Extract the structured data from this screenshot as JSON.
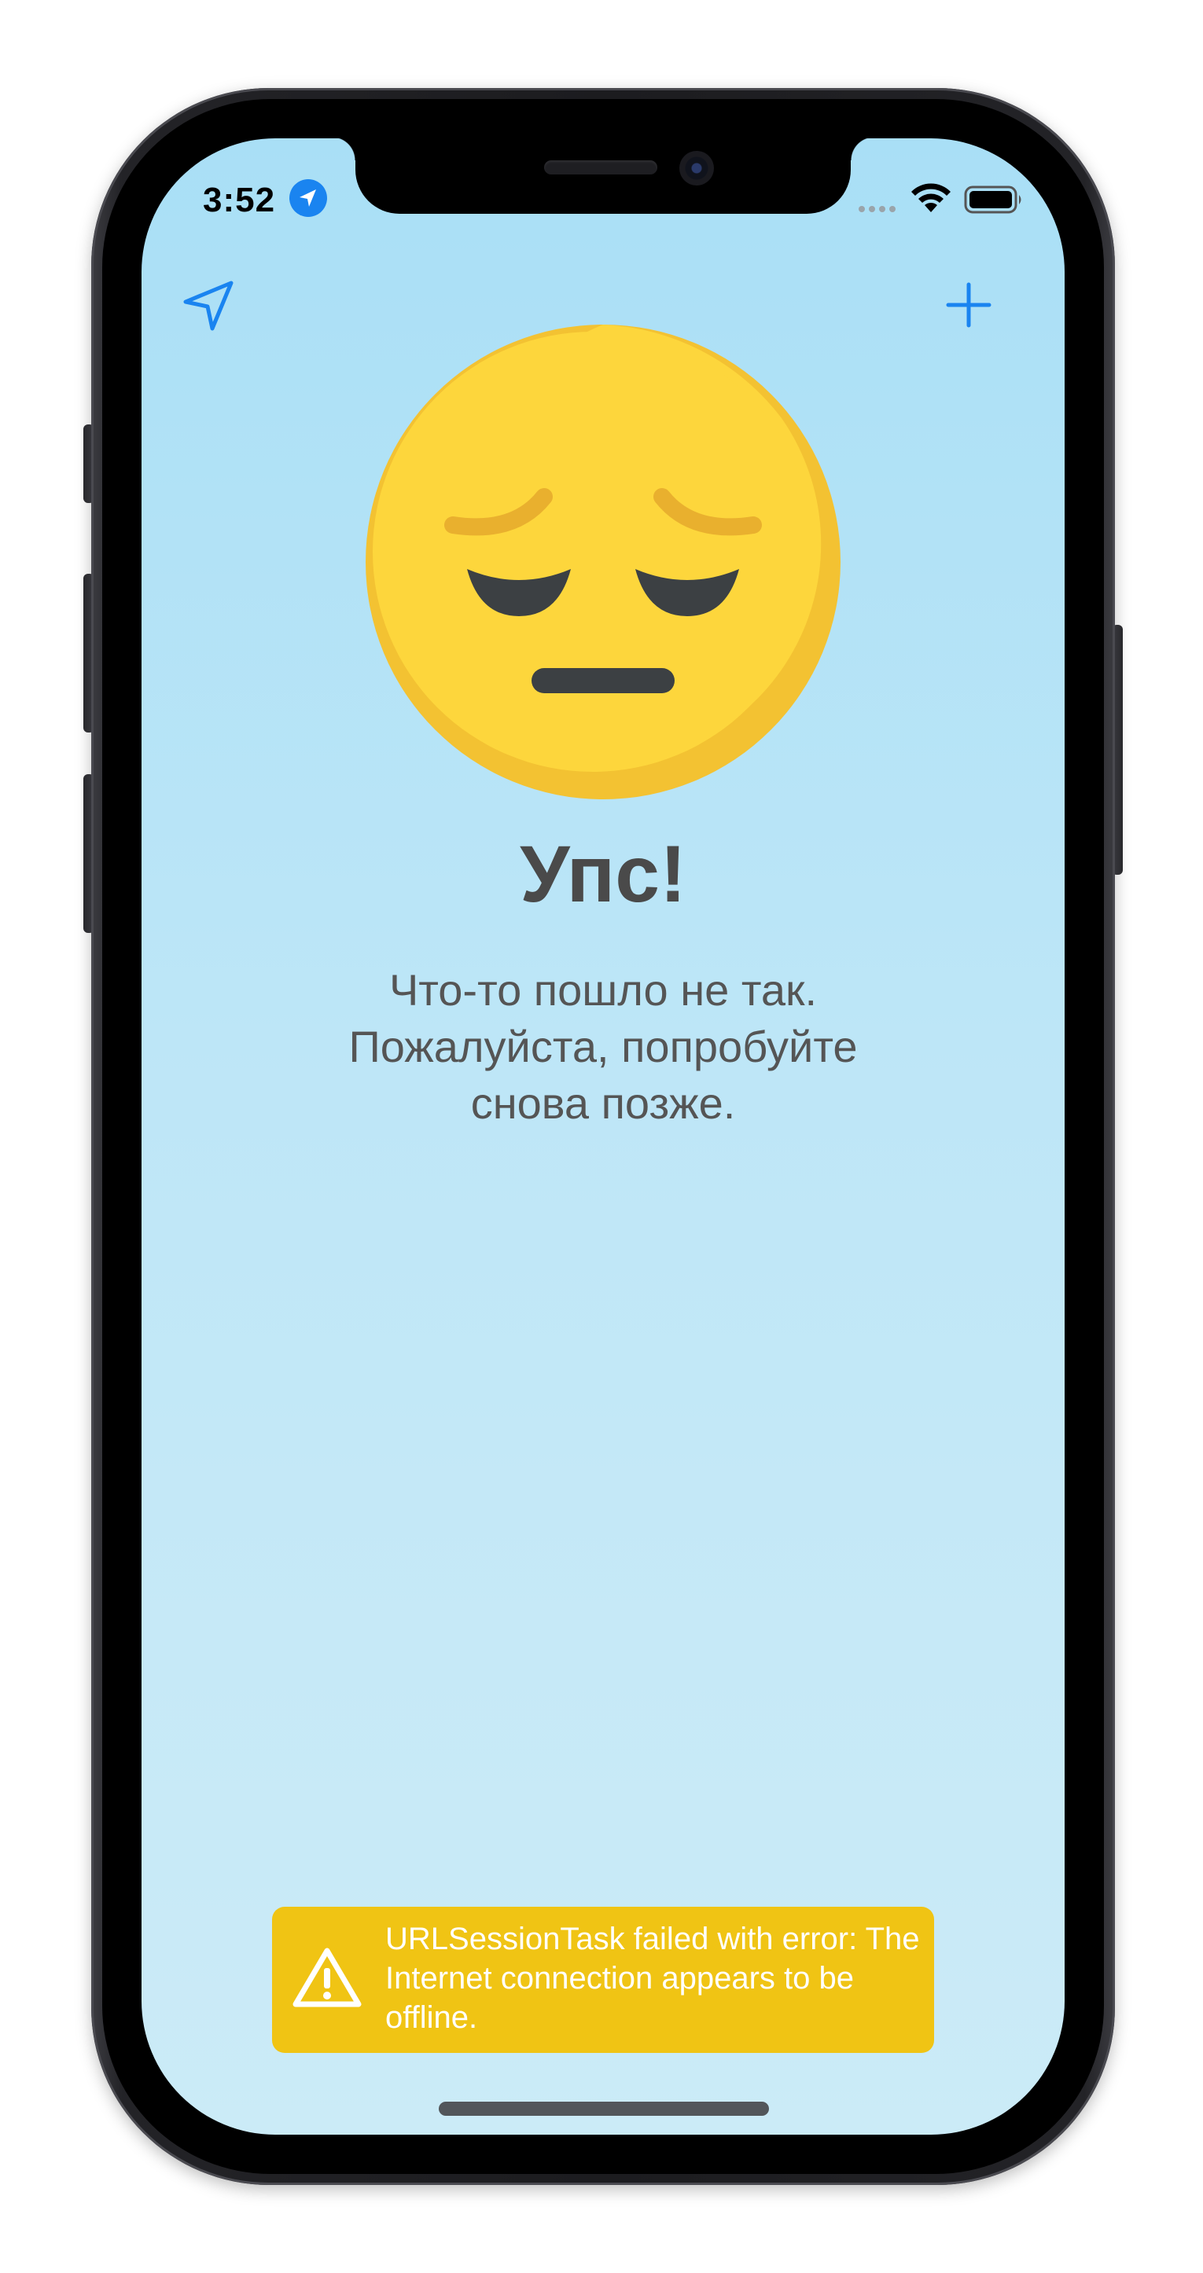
{
  "status_bar": {
    "time": "3:52",
    "location_icon": "location-arrow-icon",
    "wifi_icon": "wifi-icon",
    "battery_icon": "battery-icon"
  },
  "nav": {
    "left_icon": "location-outline-icon",
    "right_icon": "plus-icon",
    "accent_color": "#1a84f0"
  },
  "illustration": {
    "icon": "pensive-face-icon",
    "face_color": "#fdd63c"
  },
  "content": {
    "title": "Упс!",
    "message": "Что-то пошло не так. Пожалуйста, попробуйте снова позже."
  },
  "error_banner": {
    "icon": "warning-icon",
    "text": "URLSessionTask failed with error: The Internet connection appears to be offline.",
    "background_color": "#f0c414"
  }
}
